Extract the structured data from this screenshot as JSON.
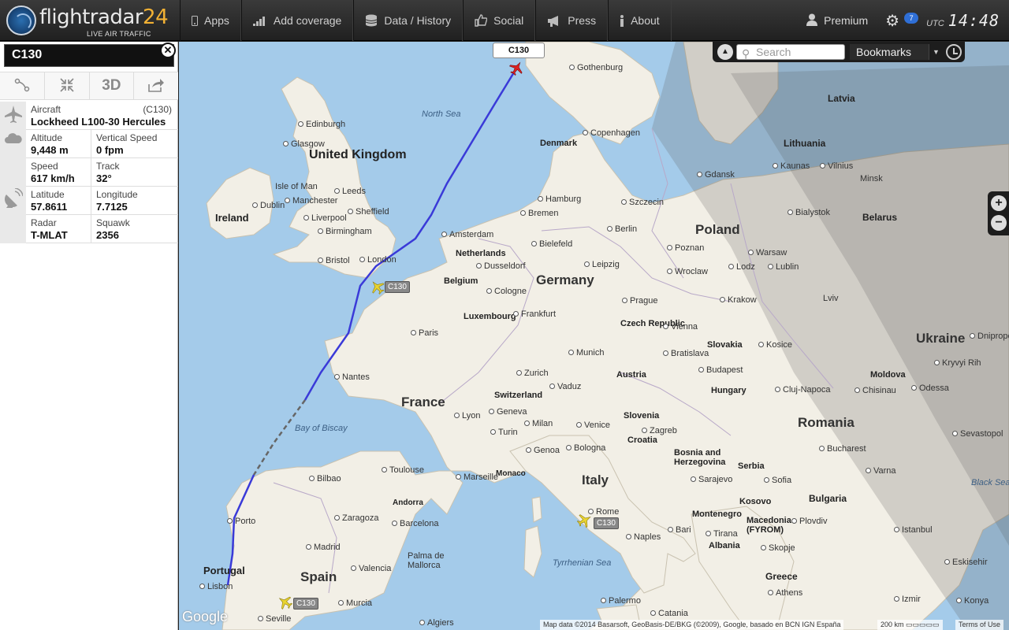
{
  "brand": {
    "name": "flightradar",
    "number": "24",
    "tagline": "LIVE AIR TRAFFIC"
  },
  "nav": [
    {
      "label": "Apps",
      "icon": "mobile-icon"
    },
    {
      "label": "Add coverage",
      "icon": "signal-bars-icon"
    },
    {
      "label": "Data / History",
      "icon": "database-icon"
    },
    {
      "label": "Social",
      "icon": "thumbs-up-icon"
    },
    {
      "label": "Press",
      "icon": "megaphone-icon"
    },
    {
      "label": "About",
      "icon": "info-icon"
    }
  ],
  "premium": {
    "label": "Premium",
    "icon": "user-icon"
  },
  "settings": {
    "icon": "gear-icon",
    "badge": "7"
  },
  "clock": {
    "zone": "UTC",
    "time": "14:48"
  },
  "flight": {
    "callsign": "C130",
    "close_icon": "close-icon",
    "tools": [
      {
        "icon": "route-icon"
      },
      {
        "icon": "collapse-icon"
      },
      {
        "label": "3D"
      },
      {
        "icon": "share-icon"
      }
    ],
    "aircraft_label": "Aircraft",
    "aircraft_code": "(C130)",
    "aircraft_name": "Lockheed L100-30 Hercules",
    "altitude_label": "Altitude",
    "altitude": "9,448 m",
    "vspeed_label": "Vertical Speed",
    "vspeed": "0 fpm",
    "speed_label": "Speed",
    "speed": "617 km/h",
    "track_label": "Track",
    "track": "32°",
    "lat_label": "Latitude",
    "lat": "57.8611",
    "lon_label": "Longitude",
    "lon": "7.7125",
    "radar_label": "Radar",
    "radar": "T-MLAT",
    "squawk_label": "Squawk",
    "squawk": "2356"
  },
  "map": {
    "search_placeholder": "Search",
    "bookmarks": "Bookmarks",
    "selected_callout": "C130",
    "other_planes": [
      {
        "tag": "C130"
      },
      {
        "tag": "C130"
      },
      {
        "tag": "C130"
      }
    ],
    "zoom_in": "+",
    "zoom_out": "−",
    "google": "Google",
    "attribution": "Map data ©2014 Basarsoft, GeoBasis-DE/BKG (©2009), Google, basado en BCN IGN España",
    "scale": "200 km",
    "terms": "Terms of Use",
    "labels": {
      "countries": [
        "United Kingdom",
        "Ireland",
        "Poland",
        "Germany",
        "France",
        "Spain",
        "Italy",
        "Romania",
        "Ukraine",
        "Portugal",
        "Belarus",
        "Lithuania",
        "Latvia",
        "Denmark",
        "Netherlands",
        "Belgium",
        "Luxembourg",
        "Switzerland",
        "Austria",
        "Czech Republic",
        "Slovakia",
        "Hungary",
        "Slovenia",
        "Croatia",
        "Bosnia and Herzegovina",
        "Serbia",
        "Montenegro",
        "Kosovo",
        "Macedonia (FYROM)",
        "Albania",
        "Greece",
        "Bulgaria",
        "Moldova",
        "Monaco",
        "Andorra"
      ],
      "cities": [
        "Edinburgh",
        "Glasgow",
        "Isle of Man",
        "Leeds",
        "Dublin",
        "Manchester",
        "Sheffield",
        "Liverpool",
        "Birmingham",
        "Bristol",
        "London",
        "Gothenburg",
        "Copenhagen",
        "Hamburg",
        "Bremen",
        "Amsterdam",
        "Berlin",
        "Bielefeld",
        "Dusseldorf",
        "Leipzig",
        "Cologne",
        "Frankfurt",
        "Prague",
        "Paris",
        "Nantes",
        "Lyon",
        "Geneva",
        "Zurich",
        "Vaduz",
        "Munich",
        "Vienna",
        "Bratislava",
        "Budapest",
        "Kosice",
        "Krakow",
        "Lodz",
        "Warsaw",
        "Poznan",
        "Wroclaw",
        "Szczecin",
        "Gdansk",
        "Kaunas",
        "Vilnius",
        "Minsk",
        "Bialystok",
        "Lublin",
        "Lviv",
        "Milan",
        "Venice",
        "Turin",
        "Genoa",
        "Bologna",
        "Zagreb",
        "Marseille",
        "Toulouse",
        "Bilbao",
        "Zaragoza",
        "Barcelona",
        "Madrid",
        "Valencia",
        "Palma de Mallorca",
        "Murcia",
        "Seville",
        "Algiers",
        "Porto",
        "Lisbon",
        "Rome",
        "Bari",
        "Naples",
        "Palermo",
        "Catania",
        "Sarajevo",
        "Tirana",
        "Skopje",
        "Sofia",
        "Plovdiv",
        "Bucharest",
        "Cluj-Napoca",
        "Chisinau",
        "Odessa",
        "Varna",
        "Istanbul",
        "Athens",
        "Izmir",
        "Eskisehir",
        "Sevastopol",
        "Kryvyi Rih",
        "Dnipropetrovsk",
        "Konya"
      ],
      "seas": [
        "North Sea",
        "Bay of Biscay",
        "Tyrrhenian Sea",
        "Black Sea"
      ]
    }
  }
}
